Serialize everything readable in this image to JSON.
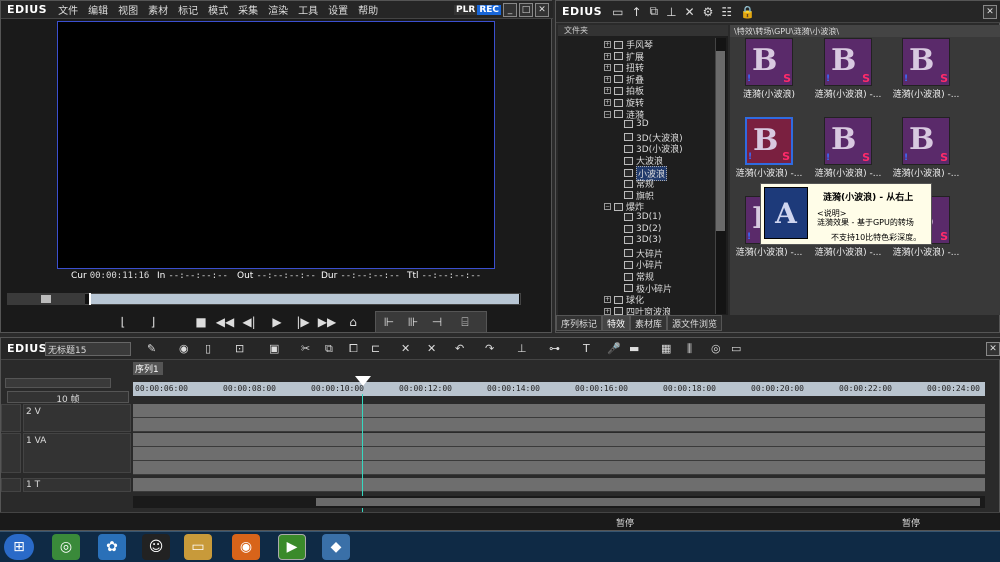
{
  "player": {
    "logo": "EDIUS",
    "menu": [
      "文件",
      "编辑",
      "视图",
      "素材",
      "标记",
      "模式",
      "采集",
      "渲染",
      "工具",
      "设置",
      "帮助"
    ],
    "plr": "PLR",
    "rec": "REC",
    "timecodes": [
      {
        "label": "Cur",
        "value": "00:00:11:16"
      },
      {
        "label": "In",
        "value": "--:--:--:--"
      },
      {
        "label": "Out",
        "value": "--:--:--:--"
      },
      {
        "label": "Dur",
        "value": "--:--:--:--"
      },
      {
        "label": "Ttl",
        "value": "--:--:--:--"
      }
    ]
  },
  "bin": {
    "logo": "EDIUS",
    "tree_header": "文件夹",
    "path": "\\特效\\转场\\GPU\\涟漪\\小波浪\\",
    "tree": [
      {
        "label": "手风琴",
        "type": "plus"
      },
      {
        "label": "扩展",
        "type": "plus"
      },
      {
        "label": "扭转",
        "type": "plus"
      },
      {
        "label": "折叠",
        "type": "plus"
      },
      {
        "label": "拍板",
        "type": "plus"
      },
      {
        "label": "旋转",
        "type": "plus"
      },
      {
        "label": "涟漪",
        "type": "minus"
      },
      {
        "label": "3D",
        "type": "child"
      },
      {
        "label": "3D(大波浪)",
        "type": "child"
      },
      {
        "label": "3D(小波浪)",
        "type": "child"
      },
      {
        "label": "大波浪",
        "type": "child"
      },
      {
        "label": "小波浪",
        "type": "child-sel"
      },
      {
        "label": "常规",
        "type": "child"
      },
      {
        "label": "旗帜",
        "type": "child"
      },
      {
        "label": "爆炸",
        "type": "minus"
      },
      {
        "label": "3D(1)",
        "type": "child"
      },
      {
        "label": "3D(2)",
        "type": "child"
      },
      {
        "label": "3D(3)",
        "type": "child"
      },
      {
        "label": "大碎片",
        "type": "child"
      },
      {
        "label": "小碎片",
        "type": "child"
      },
      {
        "label": "常规",
        "type": "child"
      },
      {
        "label": "极小碎片",
        "type": "child"
      },
      {
        "label": "球化",
        "type": "plus"
      },
      {
        "label": "四叶窗波浪",
        "type": "plus"
      }
    ],
    "tabs": [
      "序列标记",
      "特效",
      "素材库",
      "源文件浏览"
    ],
    "thumbs": [
      "涟漪(小波浪)",
      "涟漪(小波浪) -...",
      "涟漪(小波浪) -...",
      "涟漪(小波浪) -...",
      "涟漪(小波浪) -...",
      "涟漪(小波浪) -...",
      "涟漪(小波浪) -...",
      "涟漪(小波浪) -...",
      "涟漪(小波浪) -..."
    ],
    "tooltip": {
      "title": "涟漪(小波浪) - 从右上",
      "l2": "<说明>",
      "l3": "涟漪效果 - 基于GPU的转场",
      "l4": "不支持10比特色彩深度。"
    }
  },
  "timeline": {
    "logo": "EDIUS",
    "seq_title": "无标题15",
    "seq_tab": "序列1",
    "zoom": "10 帧",
    "ruler": [
      "00:00:06:00",
      "00:00:08:00",
      "00:00:10:00",
      "00:00:12:00",
      "00:00:14:00",
      "00:00:16:00",
      "00:00:18:00",
      "00:00:20:00",
      "00:00:22:00",
      "00:00:24:00"
    ],
    "tracks": [
      "2 V",
      "1 VA",
      "1 T"
    ],
    "status": [
      "暂停",
      "暂停"
    ]
  }
}
